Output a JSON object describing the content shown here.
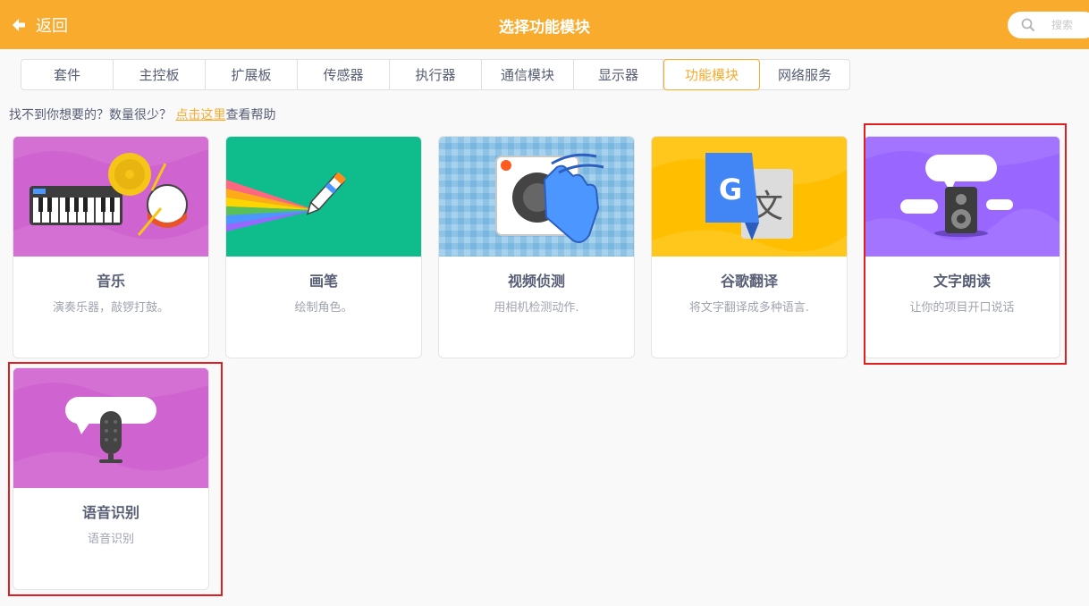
{
  "header": {
    "back_label": "返回",
    "title": "选择功能模块",
    "search_placeholder": "搜索"
  },
  "tabs": [
    {
      "label": "套件"
    },
    {
      "label": "主控板"
    },
    {
      "label": "扩展板"
    },
    {
      "label": "传感器"
    },
    {
      "label": "执行器"
    },
    {
      "label": "通信模块"
    },
    {
      "label": "显示器"
    },
    {
      "label": "功能模块",
      "active": true
    },
    {
      "label": "网络服务"
    }
  ],
  "help": {
    "prefix": "找不到你想要的？数量很少？ ",
    "link": "点击这里",
    "suffix": "查看帮助"
  },
  "cards": [
    {
      "name": "音乐",
      "desc": "演奏乐器，敲锣打鼓。",
      "icon": "music-icon",
      "color": "#cf63cf"
    },
    {
      "name": "画笔",
      "desc": "绘制角色。",
      "icon": "pen-icon",
      "color": "#0fbd8c"
    },
    {
      "name": "视频侦测",
      "desc": "用相机检测动作.",
      "icon": "video-sensing-icon",
      "color": "#8ec3e6"
    },
    {
      "name": "谷歌翻译",
      "desc": "将文字翻译成多种语言.",
      "icon": "translate-icon",
      "color": "#ffbf00"
    },
    {
      "name": "文字朗读",
      "desc": "让你的项目开口说话",
      "icon": "text-to-speech-icon",
      "color": "#9966ff"
    },
    {
      "name": "语音识别",
      "desc": "语音识别",
      "icon": "speech-recognition-icon",
      "color": "#cf63cf"
    }
  ],
  "colors": {
    "accent": "#f9ab2e",
    "highlight": "#e02020"
  }
}
